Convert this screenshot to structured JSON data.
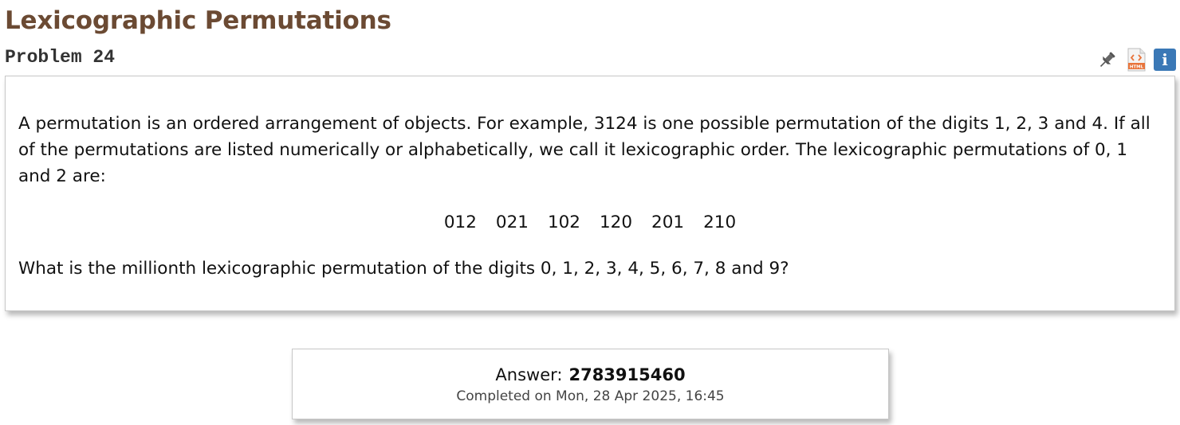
{
  "header": {
    "title": "Lexicographic Permutations",
    "problem_label": "Problem 24"
  },
  "icons": {
    "pin": "pin-icon",
    "html": "html-file-icon",
    "info": "info-icon",
    "info_glyph": "i",
    "html_label": "HTML"
  },
  "problem": {
    "paragraph1": "A permutation is an ordered arrangement of objects. For example, 3124 is one possible permutation of the digits 1, 2, 3 and 4. If all of the permutations are listed numerically or alphabetically, we call it lexicographic order. The lexicographic permutations of 0, 1 and 2 are:",
    "permutations": [
      "012",
      "021",
      "102",
      "120",
      "201",
      "210"
    ],
    "question": "What is the millionth lexicographic permutation of the digits 0, 1, 2, 3, 4, 5, 6, 7, 8 and 9?"
  },
  "answer": {
    "label": "Answer:",
    "value": "2783915460",
    "completed": "Completed on Mon, 28 Apr 2025, 16:45"
  },
  "colors": {
    "title": "#6b4a33",
    "info_bg": "#3a78b6",
    "html_icon_accent": "#e8743b"
  }
}
